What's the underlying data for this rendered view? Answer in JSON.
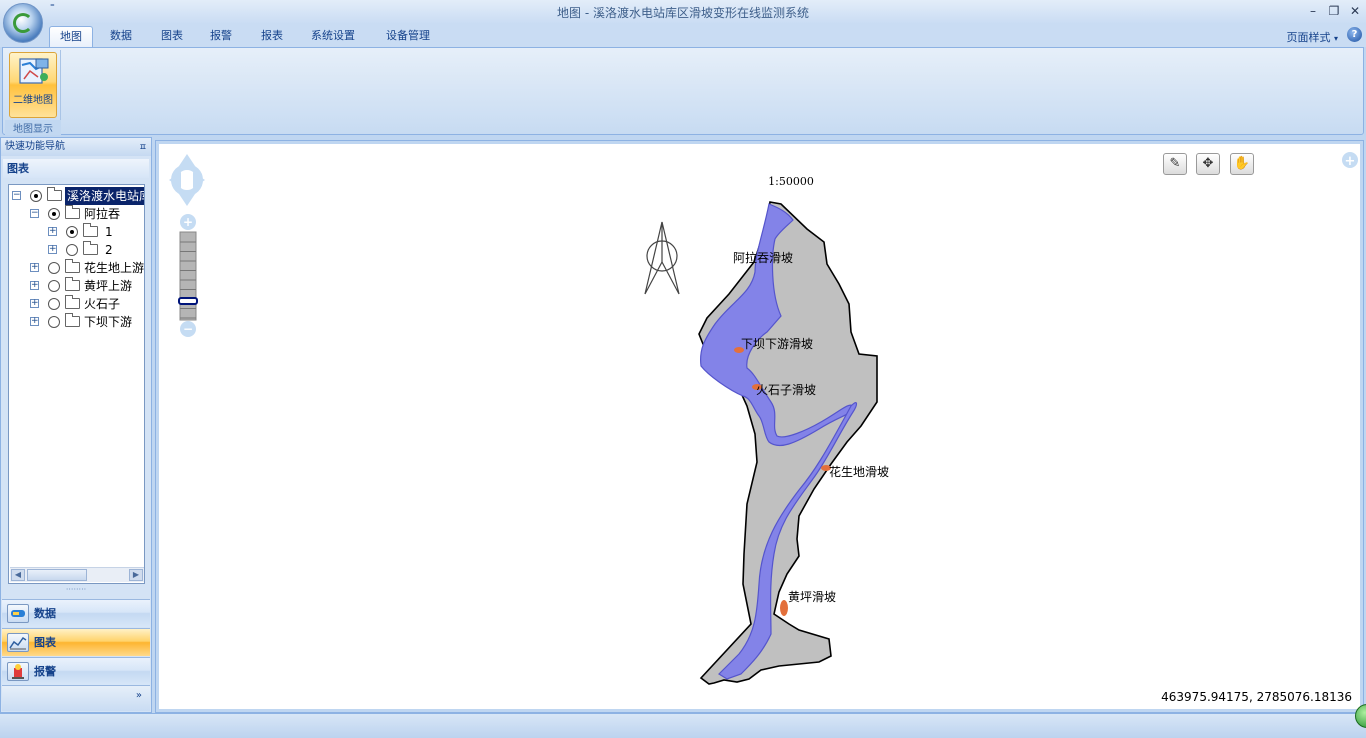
{
  "window": {
    "title": "地图 - 溪洛渡水电站库区滑坡变形在线监测系统",
    "qat_symbol": "⁼",
    "minimize": "–",
    "restore": "❐",
    "close": "✕"
  },
  "ribbon": {
    "tabs": [
      {
        "label": "地图",
        "active": true
      },
      {
        "label": "数据",
        "active": false
      },
      {
        "label": "图表",
        "active": false
      },
      {
        "label": "报警",
        "active": false
      },
      {
        "label": "报表",
        "active": false
      },
      {
        "label": "系统设置",
        "active": false
      },
      {
        "label": "设备管理",
        "active": false
      }
    ],
    "page_style": "页面样式",
    "help": "?",
    "groups": [
      {
        "label": "地图显示",
        "buttons": [
          {
            "label": "二维地图",
            "icon": "map-2d-icon"
          }
        ]
      }
    ]
  },
  "left_panel": {
    "header": "快速功能导航",
    "pin": "ㅍ",
    "section_title": "图表",
    "tree": [
      {
        "label": "溪洛渡水电站库区",
        "expanded": true,
        "radio": true,
        "selected": true
      },
      {
        "label": "阿拉吞",
        "expanded": true,
        "radio": true
      },
      {
        "label": "1",
        "expanded": false,
        "radio": true
      },
      {
        "label": "2",
        "expanded": false,
        "radio": false
      },
      {
        "label": "花生地上游",
        "expanded": false,
        "radio": false
      },
      {
        "label": "黄坪上游",
        "expanded": false,
        "radio": false
      },
      {
        "label": "火石子",
        "expanded": false,
        "radio": false
      },
      {
        "label": "下坝下游",
        "expanded": false,
        "radio": false
      }
    ],
    "nav_buttons": [
      {
        "label": "数据",
        "icon": "data-icon",
        "active": false
      },
      {
        "label": "图表",
        "icon": "chart-icon",
        "active": true
      },
      {
        "label": "报警",
        "icon": "alarm-icon",
        "active": false
      }
    ],
    "more": "»"
  },
  "map": {
    "scale": "1:50000",
    "coordinates": "463975.94175, 2785076.18136",
    "labels": [
      "阿拉吞滑坡",
      "下坝下游滑坡",
      "火石子滑坡",
      "花生地滑坡",
      "黄坪滑坡"
    ],
    "tools": [
      {
        "name": "edit-tool",
        "glyph": "✎"
      },
      {
        "name": "pan-tool",
        "glyph": "✥"
      },
      {
        "name": "hand-tool",
        "glyph": "✋"
      }
    ],
    "zoom_in": "+",
    "zoom_out": "−",
    "expand": "+",
    "colors": {
      "terrain": "#c0c0c0",
      "river": "#8383e8",
      "landslide": "#e3703c"
    }
  }
}
